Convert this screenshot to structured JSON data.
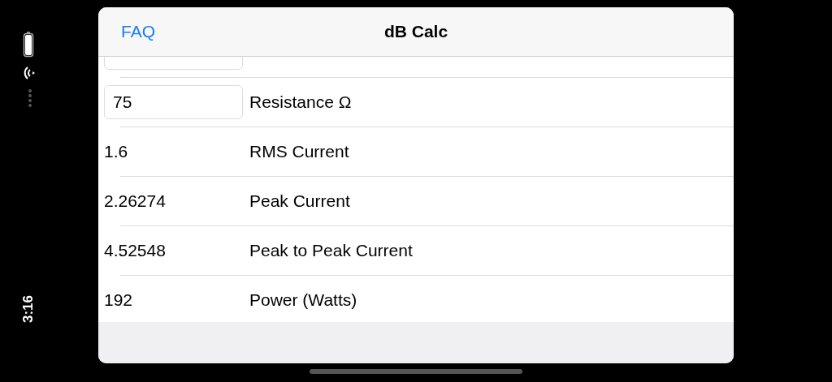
{
  "status": {
    "time": "3:16"
  },
  "nav": {
    "left_button": "FAQ",
    "title": "dB Calc"
  },
  "rows": [
    {
      "kind": "clipped"
    },
    {
      "kind": "input",
      "value": "75",
      "label": "Resistance Ω"
    },
    {
      "kind": "value",
      "value": "1.6",
      "label": "RMS Current"
    },
    {
      "kind": "value",
      "value": "2.26274",
      "label": "Peak Current"
    },
    {
      "kind": "value",
      "value": "4.52548",
      "label": "Peak to Peak Current"
    },
    {
      "kind": "value",
      "value": "192",
      "label": "Power (Watts)"
    }
  ]
}
